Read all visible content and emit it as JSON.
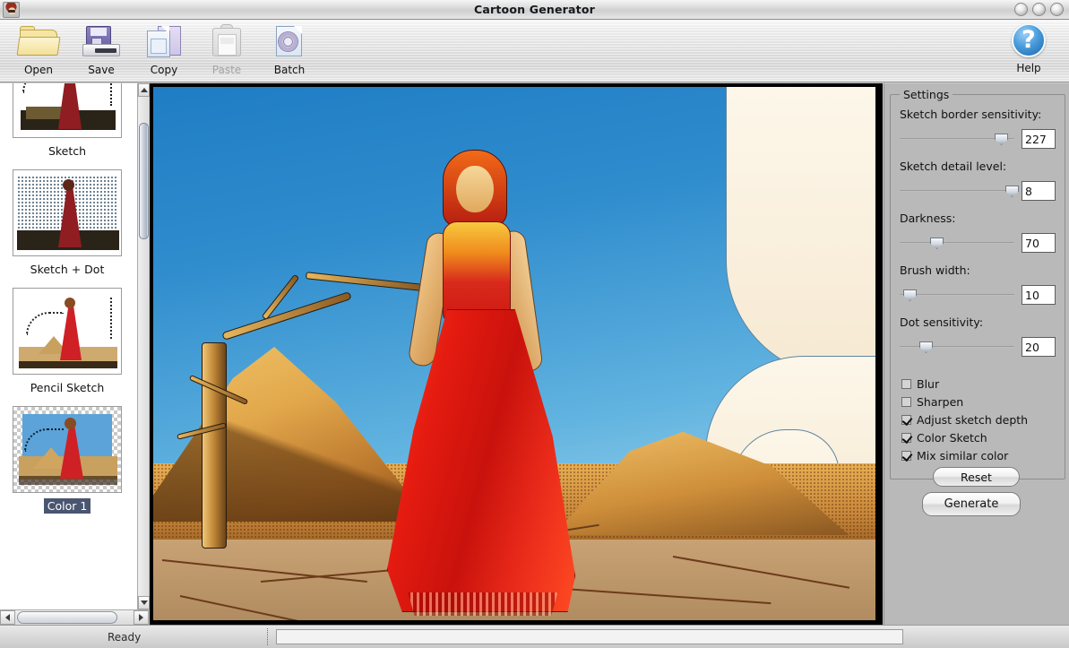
{
  "window": {
    "title": "Cartoon Generator",
    "app_icon": "cartoon-face-icon",
    "controls": [
      "minimize-button",
      "maximize-button",
      "close-button"
    ]
  },
  "toolbar": {
    "items": [
      {
        "label": "Open",
        "icon": "open-folder-icon",
        "enabled": true
      },
      {
        "label": "Save",
        "icon": "floppy-disk-icon",
        "enabled": true
      },
      {
        "label": "Copy",
        "icon": "copy-pages-icon",
        "enabled": true
      },
      {
        "label": "Paste",
        "icon": "clipboard-icon",
        "enabled": false
      },
      {
        "label": "Batch",
        "icon": "gear-page-icon",
        "enabled": true
      }
    ],
    "help": {
      "label": "Help",
      "icon": "help-question-icon"
    }
  },
  "sidebar": {
    "thumbnails": [
      {
        "label": "Sketch",
        "selected": false
      },
      {
        "label": "Sketch + Dot",
        "selected": false
      },
      {
        "label": "Pencil Sketch",
        "selected": false
      },
      {
        "label": "Color 1",
        "selected": true
      }
    ],
    "vscroll": {
      "up": "scroll-up-arrow",
      "down": "scroll-down-arrow"
    },
    "hscroll": {
      "left": "scroll-left-arrow",
      "right": "scroll-right-arrow"
    }
  },
  "settings": {
    "group_title": "Settings",
    "sliders": [
      {
        "label": "Sketch border sensitivity:",
        "value": "227",
        "percent": 88
      },
      {
        "label": "Sketch detail level:",
        "value": "8",
        "percent": 97
      },
      {
        "label": "Darkness:",
        "value": "70",
        "percent": 29
      },
      {
        "label": "Brush width:",
        "value": "10",
        "percent": 6
      },
      {
        "label": "Dot sensitivity:",
        "value": "20",
        "percent": 21
      }
    ],
    "checkboxes": [
      {
        "label": "Blur",
        "checked": false
      },
      {
        "label": "Sharpen",
        "checked": false
      },
      {
        "label": "Adjust sketch depth",
        "checked": true
      },
      {
        "label": "Color Sketch",
        "checked": true
      },
      {
        "label": "Mix similar color",
        "checked": true
      }
    ],
    "reset_label": "Reset",
    "generate_label": "Generate"
  },
  "statusbar": {
    "message": "Ready",
    "progress_value": ""
  },
  "colors": {
    "accent": "#4a9ddc",
    "panel": "#b9b9b9",
    "sky": "#2f8ccd",
    "dress": "#d8261a",
    "sand": "#e8ae53",
    "selection": "#4a5570"
  }
}
